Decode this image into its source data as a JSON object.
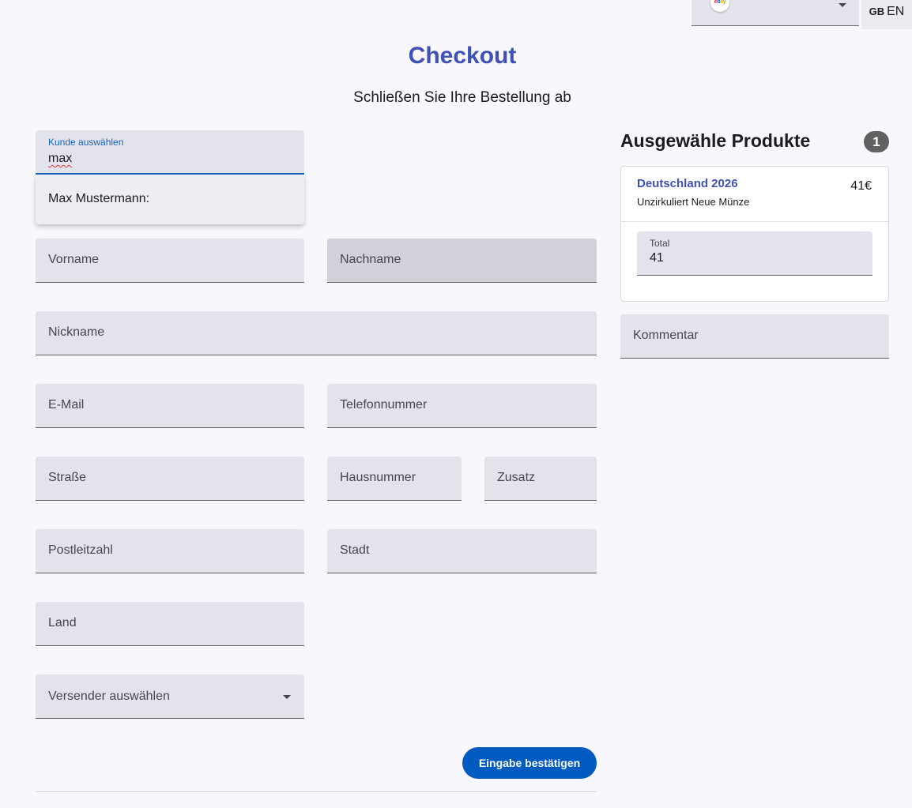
{
  "topbar": {
    "shop_logo_text": "ebay",
    "shop_logo_icon": "ebay-logo",
    "language": {
      "flag": "GB",
      "code": "EN"
    }
  },
  "header": {
    "title": "Checkout",
    "subtitle": "Schließen Sie Ihre Bestellung ab"
  },
  "customer": {
    "label": "Kunde auswählen",
    "value": "max",
    "suggestion": "Max Mustermann:"
  },
  "form": {
    "vorname": "Vorname",
    "nachname": "Nachname",
    "nickname": "Nickname",
    "email": "E-Mail",
    "telefon": "Telefonnummer",
    "strasse": "Straße",
    "hausnummer": "Hausnummer",
    "zusatz": "Zusatz",
    "plz": "Postleitzahl",
    "stadt": "Stadt",
    "land": "Land",
    "versender": "Versender auswählen",
    "submit": "Eingabe bestätigen"
  },
  "products": {
    "title": "Ausgewähle Produkte",
    "count": "1",
    "items": [
      {
        "name": "Deutschland 2026",
        "description": "Unzirkuliert Neue Münze",
        "price": "41€"
      }
    ],
    "total_label": "Total",
    "total_value": "41",
    "comment_placeholder": "Kommentar"
  },
  "colors": {
    "accent": "#3f51b5",
    "primary_button": "#005bc1",
    "field_bg": "#e2e3eb",
    "background": "#f8f7fb"
  }
}
